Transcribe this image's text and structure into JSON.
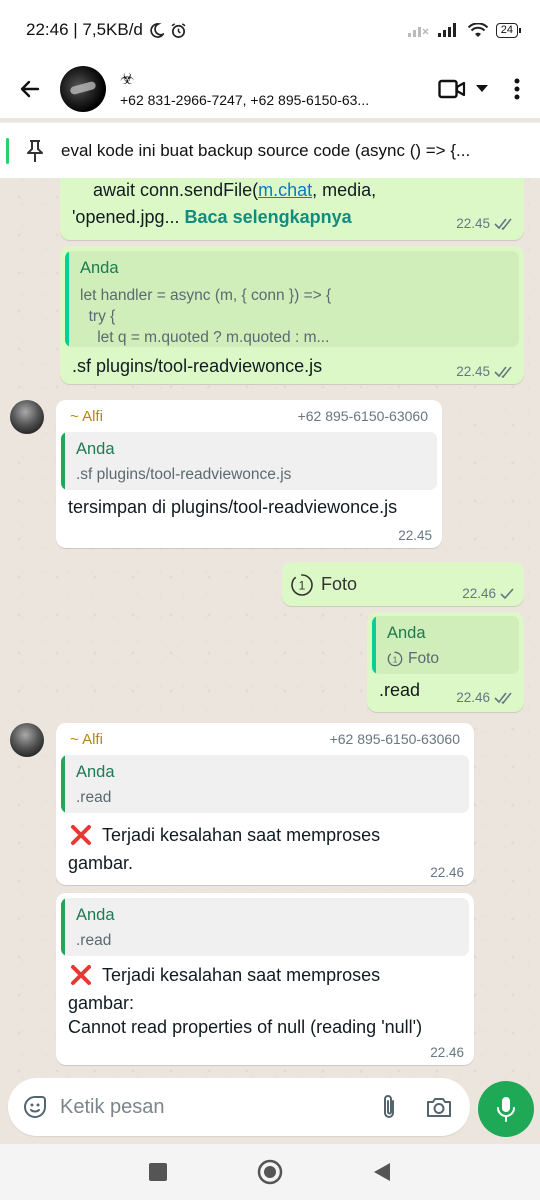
{
  "status_bar": {
    "time_speed": "22:46 | 7,5KB/d",
    "battery": "24"
  },
  "header": {
    "title_icon": "☣",
    "subtitle": "+62 831-2966-7247, +62 895-6150-63..."
  },
  "pinned": {
    "text": "eval kode ini buat backup source code (async () => {..."
  },
  "messages": [
    {
      "type": "outgoing",
      "line1_prefix": "await conn.sendFile(",
      "line1_link": "m.chat",
      "line1_suffix": ", media,",
      "line2": "'opened.jpg... ",
      "read_more": "Baca selengkapnya",
      "time": "22.45"
    },
    {
      "type": "outgoing",
      "quote_name": "Anda",
      "quote_body": "let handler = async (m, { conn }) => {\n  try {\n    let q = m.quoted ? m.quoted : m...",
      "text": ".sf plugins/tool-readviewonce.js",
      "time": "22.45"
    },
    {
      "type": "incoming",
      "sender": "~ Alfi",
      "sender_number": "+62 895-6150-63060",
      "quote_name": "Anda",
      "quote_body": ".sf plugins/tool-readviewonce.js",
      "text": "tersimpan di plugins/tool-readviewonce.js",
      "time": "22.45"
    },
    {
      "type": "outgoing",
      "text": "Foto",
      "time": "22.46"
    },
    {
      "type": "outgoing",
      "quote_name": "Anda",
      "quote_body": "Foto",
      "text": ".read",
      "time": "22.46"
    },
    {
      "type": "incoming",
      "sender": "~ Alfi",
      "sender_number": "+62 895-6150-63060",
      "quote_name": "Anda",
      "quote_body": ".read",
      "text_line1": "Terjadi kesalahan saat memproses",
      "text_line2": "gambar.",
      "time": "22.46"
    },
    {
      "type": "incoming",
      "quote_name": "Anda",
      "quote_body": ".read",
      "text_line1": "Terjadi kesalahan saat memproses",
      "text_line2": "gambar:",
      "text_line3": "Cannot read properties of null (reading 'null')",
      "time": "22.46"
    }
  ],
  "input": {
    "placeholder": "Ketik pesan"
  },
  "colors": {
    "accent": "#1fa855",
    "bubble_out": "#dcf8c6",
    "bubble_in": "#ffffff",
    "error": "#e53935"
  },
  "icons": [
    "back-arrow-icon",
    "video-call-icon",
    "dropdown-icon",
    "more-icon",
    "pin-icon",
    "sticker-icon",
    "attach-icon",
    "camera-icon",
    "mic-icon",
    "view-once-icon",
    "double-check-icon",
    "check-icon",
    "error-cross-icon"
  ]
}
